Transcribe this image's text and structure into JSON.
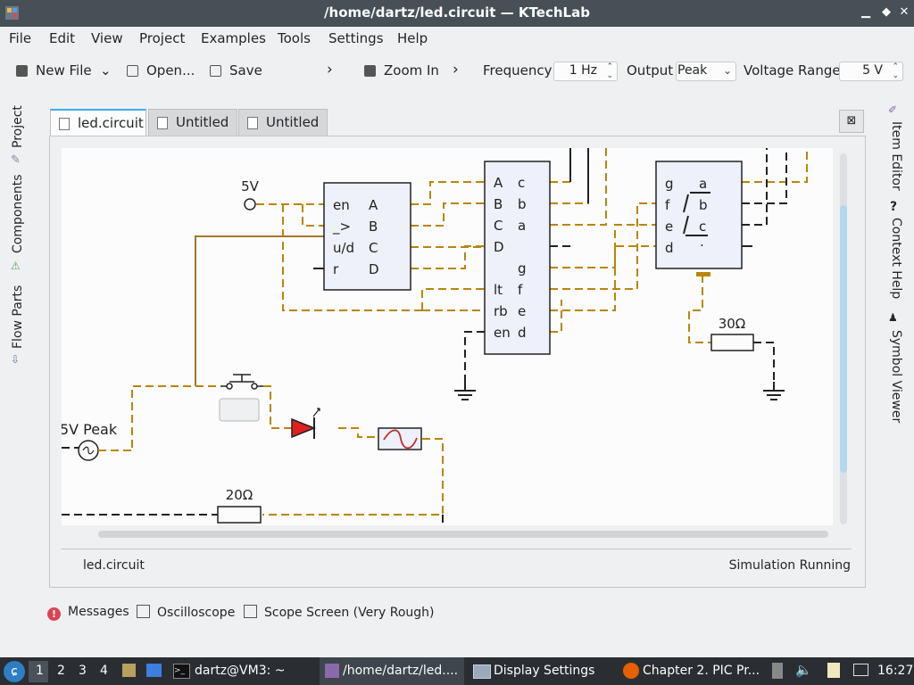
{
  "window": {
    "title": "/home/dartz/led.circuit — KTechLab",
    "controls": [
      "minimize",
      "maximize",
      "close"
    ]
  },
  "menubar": [
    "File",
    "Edit",
    "View",
    "Project",
    "Examples",
    "Tools",
    "Settings",
    "Help"
  ],
  "toolbar": {
    "new_file": "New File",
    "open": "Open...",
    "save": "Save",
    "zoom_in": "Zoom In",
    "frequency_label": "Frequency",
    "frequency_value": "1 Hz",
    "output_label": "Output",
    "output_value": "Peak",
    "voltage_range_label": "Voltage Range",
    "voltage_range_value": "5 V"
  },
  "left_sidebar": [
    "Project",
    "Components",
    "Flow Parts"
  ],
  "right_sidebar": [
    "Item Editor",
    "Context Help",
    "Symbol Viewer"
  ],
  "doc_tabs": [
    {
      "label": "led.circuit",
      "active": true
    },
    {
      "label": "Untitled",
      "active": false
    },
    {
      "label": "Untitled",
      "active": false
    }
  ],
  "circuit": {
    "vcc_label": "5V",
    "counter_pins_left": [
      "en",
      "_>",
      "u/d",
      "r"
    ],
    "counter_pins_right": [
      "A",
      "B",
      "C",
      "D"
    ],
    "decoder_pins_left": [
      "A",
      "B",
      "C",
      "D",
      "",
      "lt",
      "rb",
      "en"
    ],
    "decoder_pins_right": [
      "c",
      "b",
      "a",
      "",
      "g",
      "f",
      "e",
      "d"
    ],
    "display_pins_left": [
      "g",
      "f",
      "e",
      "d"
    ],
    "display_segments": [
      "a",
      "b",
      "c",
      "."
    ],
    "source_label": "5V Peak",
    "resistor_top_label": "30Ω",
    "resistor_bottom_label": "20Ω",
    "wire_color": "#b8860b",
    "wire_active_color": "#a0782a",
    "led_color": "#e02020"
  },
  "status": {
    "file": "led.circuit",
    "state": "Simulation Running"
  },
  "bottom_dock": [
    "Messages",
    "Oscilloscope",
    "Scope Screen (Very Rough)"
  ],
  "taskbar": {
    "desktops": [
      "1",
      "2",
      "3",
      "4"
    ],
    "tasks": [
      "dartz@VM3: ~",
      "/home/dartz/led....",
      "Display Settings",
      "Chapter 2. PIC Pr..."
    ],
    "clock": "16:27"
  }
}
